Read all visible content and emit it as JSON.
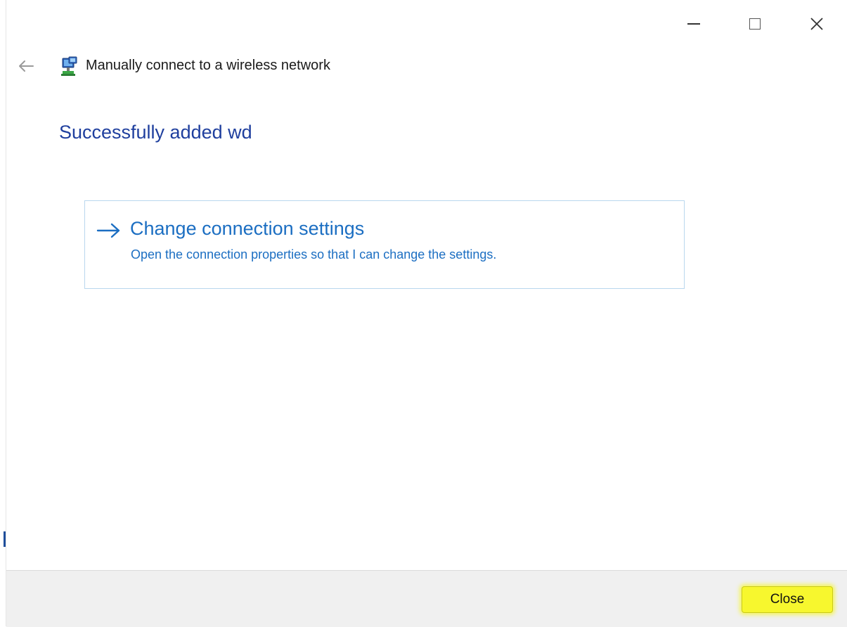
{
  "window": {
    "title": "Manually connect to a wireless network",
    "caption_buttons": {
      "minimize_icon": "minimize-icon",
      "maximize_icon": "maximize-icon",
      "close_icon": "close-icon"
    },
    "back_icon": "back-arrow-icon",
    "app_icon": "network-icon"
  },
  "main": {
    "headline": "Successfully added wd",
    "command_link": {
      "title": "Change connection settings",
      "description": "Open the connection properties so that I can change the settings.",
      "icon": "arrow-right-icon"
    }
  },
  "footer": {
    "close_label": "Close",
    "highlight_color": "#f7f72e"
  },
  "colors": {
    "headline": "#1f3f9e",
    "link": "#1b6ec2",
    "link_border": "#b9d7ee",
    "footer_bg": "#f0f0f0"
  }
}
